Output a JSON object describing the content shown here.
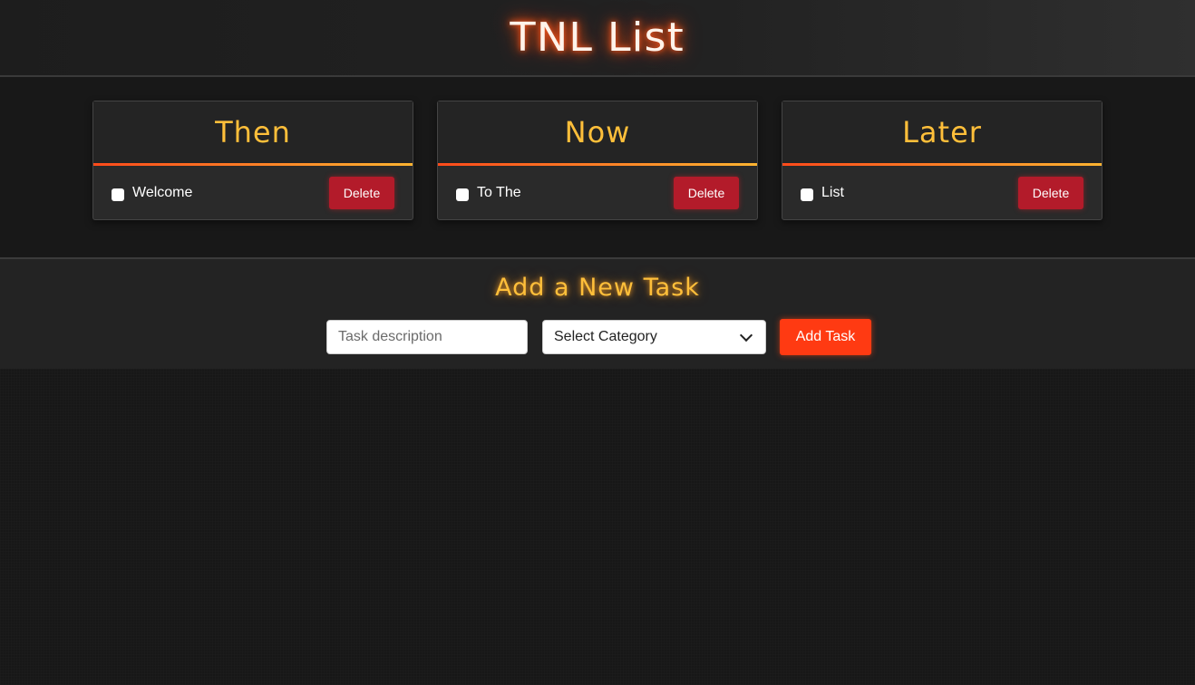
{
  "header": {
    "title": "TNL List"
  },
  "columns": [
    {
      "title": "Then",
      "tasks": [
        {
          "text": "Welcome",
          "delete_label": "Delete"
        }
      ]
    },
    {
      "title": "Now",
      "tasks": [
        {
          "text": "To The",
          "delete_label": "Delete"
        }
      ]
    },
    {
      "title": "Later",
      "tasks": [
        {
          "text": "List",
          "delete_label": "Delete"
        }
      ]
    }
  ],
  "add_task": {
    "title": "Add a New Task",
    "input_placeholder": "Task description",
    "category_selected": "Select Category",
    "button_label": "Add Task"
  },
  "colors": {
    "accent_orange": "#ff3a12",
    "accent_yellow": "#ffbf3a",
    "delete_red": "#b31b2a",
    "background": "#171717"
  }
}
